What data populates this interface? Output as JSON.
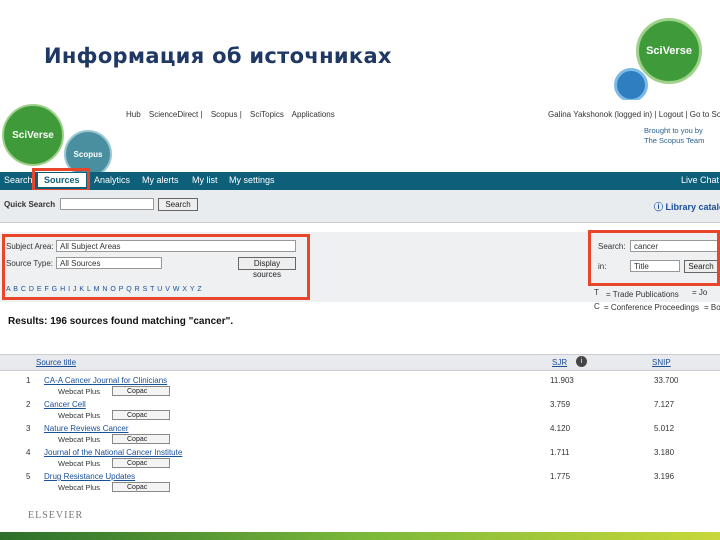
{
  "slide": {
    "title": "Информация об источниках",
    "logo_text": "SciVerse"
  },
  "header": {
    "logo_sciverse": "SciVerse",
    "logo_scopus": "Scopus",
    "links": [
      "Hub",
      "ScienceDirect |",
      "Scopus |",
      "SciTopics",
      "Applications"
    ],
    "user": "Galina Yakshonok (logged in) | Logout | Go to SciVal",
    "brought_line1": "Brought to you by",
    "brought_line2": "The Scopus Team"
  },
  "nav": {
    "items": [
      "Search",
      "Sources",
      "Analytics",
      "My alerts",
      "My list",
      "My settings"
    ],
    "right": "Live Chat"
  },
  "quick_search": {
    "label": "Quick Search",
    "value": "",
    "button": "Search",
    "library": "Library catalogue"
  },
  "filter": {
    "subject_label": "Subject Area:",
    "subject_value": "All Subject Areas",
    "type_label": "Source Type:",
    "type_value": "All Sources",
    "display_button": "Display sources",
    "alphabet": "A B C D E F G H I J K L M N O P Q R S T U V W X Y Z"
  },
  "search_box": {
    "search_label": "Search:",
    "search_value": "cancer",
    "in_label": "in:",
    "in_value": "Title",
    "button": "Search"
  },
  "legend": {
    "trade": "= Trade Publications",
    "conf": "= Conference Proceedings",
    "trade_icon": "T",
    "conf_icon": "C",
    "right1": "= Jo",
    "right2": "= Bo"
  },
  "results": {
    "text": "Results: 196 sources found matching \"cancer\"."
  },
  "table": {
    "col_title": "Source title",
    "col_sjr": "SJR",
    "col_snip": "SNIP",
    "rows": [
      {
        "num": "1",
        "title": "CA-A Cancer Journal for Clinicians",
        "sjr": "11.903",
        "snip": "33.700"
      },
      {
        "num": "2",
        "title": "Cancer Cell",
        "sjr": "3.759",
        "snip": "7.127"
      },
      {
        "num": "3",
        "title": "Nature Reviews Cancer",
        "sjr": "4.120",
        "snip": "5.012"
      },
      {
        "num": "4",
        "title": "Journal of the National Cancer Institute",
        "sjr": "1.711",
        "snip": "3.180"
      },
      {
        "num": "5",
        "title": "Drug Resistance Updates",
        "sjr": "1.775",
        "snip": "3.196"
      }
    ],
    "webcat": "Webcat Plus",
    "copac": "Copac"
  },
  "footer": {
    "elsevier": "ELSEVIER"
  }
}
